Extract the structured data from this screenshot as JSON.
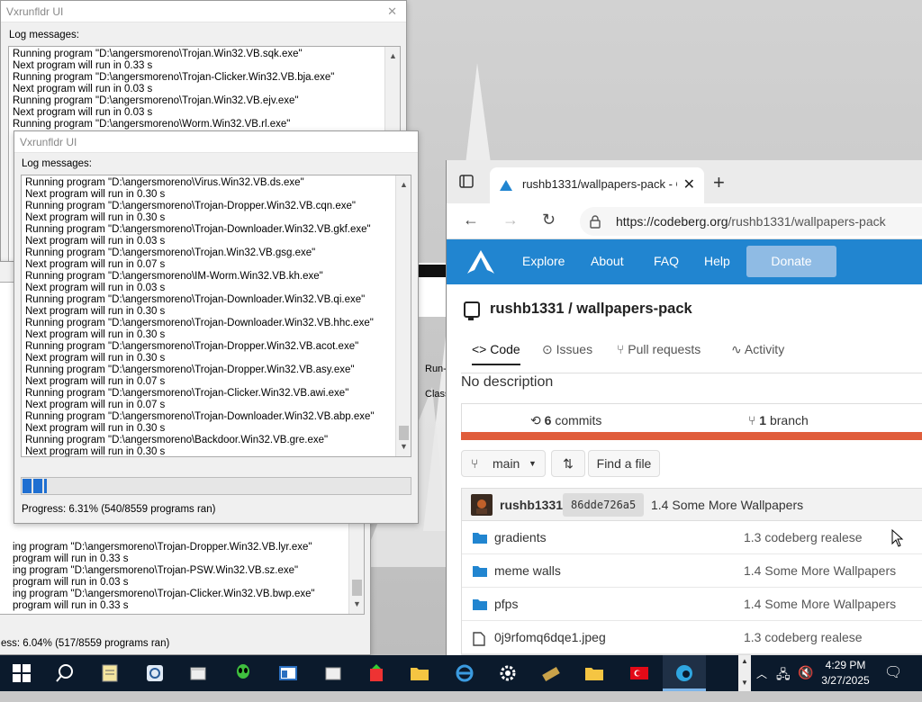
{
  "log_window_back": {
    "title": "Vxrunfldr UI",
    "log_label": "Log messages:",
    "lines": [
      "Running program \"D:\\angersmoreno\\Trojan.Win32.VB.sqk.exe\"",
      "Next program will run in 0.33 s",
      "Running program \"D:\\angersmoreno\\Trojan-Clicker.Win32.VB.bja.exe\"",
      "Next program will run in 0.03 s",
      "Running program \"D:\\angersmoreno\\Trojan.Win32.VB.ejv.exe\"",
      "Next program will run in 0.03 s",
      "Running program \"D:\\angersmoreno\\Worm.Win32.VB.rl.exe\""
    ]
  },
  "log_window_left": {
    "lines": [
      "ing program \"D:\\angersmoreno\\Trojan-Dropper.Win32.VB.lyr.exe\"",
      "program will run in 0.33 s",
      "ing program \"D:\\angersmoreno\\Trojan-PSW.Win32.VB.sz.exe\"",
      "program will run in 0.03 s",
      "ing program \"D:\\angersmoreno\\Trojan-Clicker.Win32.VB.bwp.exe\"",
      "program will run in 0.33 s"
    ],
    "progress_text": "ess: 6.04% (517/8559 programs ran)",
    "side_text_1": "Run-",
    "side_text_2": "Class"
  },
  "log_window_front": {
    "title": "Vxrunfldr UI",
    "log_label": "Log messages:",
    "lines": [
      "Running program \"D:\\angersmoreno\\Virus.Win32.VB.ds.exe\"",
      "Next program will run in 0.30 s",
      "Running program \"D:\\angersmoreno\\Trojan-Dropper.Win32.VB.cqn.exe\"",
      "Next program will run in 0.30 s",
      "Running program \"D:\\angersmoreno\\Trojan-Downloader.Win32.VB.gkf.exe\"",
      "Next program will run in 0.03 s",
      "Running program \"D:\\angersmoreno\\Trojan.Win32.VB.gsg.exe\"",
      "Next program will run in 0.07 s",
      "Running program \"D:\\angersmoreno\\IM-Worm.Win32.VB.kh.exe\"",
      "Next program will run in 0.03 s",
      "Running program \"D:\\angersmoreno\\Trojan-Downloader.Win32.VB.qi.exe\"",
      "Next program will run in 0.30 s",
      "Running program \"D:\\angersmoreno\\Trojan-Downloader.Win32.VB.hhc.exe\"",
      "Next program will run in 0.30 s",
      "Running program \"D:\\angersmoreno\\Trojan-Dropper.Win32.VB.acot.exe\"",
      "Next program will run in 0.30 s",
      "Running program \"D:\\angersmoreno\\Trojan-Dropper.Win32.VB.asy.exe\"",
      "Next program will run in 0.07 s",
      "Running program \"D:\\angersmoreno\\Trojan-Clicker.Win32.VB.awi.exe\"",
      "Next program will run in 0.07 s",
      "Running program \"D:\\angersmoreno\\Trojan-Downloader.Win32.VB.abp.exe\"",
      "Next program will run in 0.30 s",
      "Running program \"D:\\angersmoreno\\Backdoor.Win32.VB.gre.exe\"",
      "Next program will run in 0.30 s"
    ],
    "progress_fraction": 0.0631,
    "progress_text": "Progress: 6.31% (540/8559 programs ran)"
  },
  "browser": {
    "tab_title": "rushb1331/wallpapers-pack - Co",
    "url_host": "https://codeberg.org",
    "url_path": "/rushb1331/wallpapers-pack",
    "nav": [
      "Explore",
      "About",
      "FAQ",
      "Help"
    ],
    "donate": "Donate",
    "repo_title": "rushb1331 / wallpapers-pack",
    "tabs": [
      "Code",
      "Issues",
      "Pull requests",
      "Activity"
    ],
    "description": "No description",
    "commits_count": "6",
    "commits_label": "commits",
    "branch_count": "1",
    "branch_label": "branch",
    "branch_name": "main",
    "find_file": "Find a file",
    "last_commit_user": "rushb1331",
    "last_commit_sha": "86dde726a5",
    "last_commit_msg": "1.4 Some More Wallpapers",
    "files": [
      {
        "name": "gradients",
        "type": "folder",
        "msg": "1.3 codeberg realese"
      },
      {
        "name": "meme walls",
        "type": "folder",
        "msg": "1.4 Some More Wallpapers"
      },
      {
        "name": "pfps",
        "type": "folder",
        "msg": "1.4 Some More Wallpapers"
      },
      {
        "name": "0j9rfomq6dqe1.jpeg",
        "type": "file",
        "msg": "1.3 codeberg realese"
      }
    ],
    "accent": "#2185d0",
    "lang_color": "#e05d3b"
  },
  "taskbar": {
    "time": "4:29 PM",
    "date": "3/27/2025",
    "icons": [
      "windows-start",
      "search",
      "notepad",
      "settings-app",
      "file-explorer",
      "alien-app",
      "window-app",
      "file-explorer-2",
      "tool-app",
      "folder",
      "edge-legacy",
      "settings-gear",
      "tool-app-2",
      "folder-2",
      "flag-app",
      "edge"
    ]
  }
}
